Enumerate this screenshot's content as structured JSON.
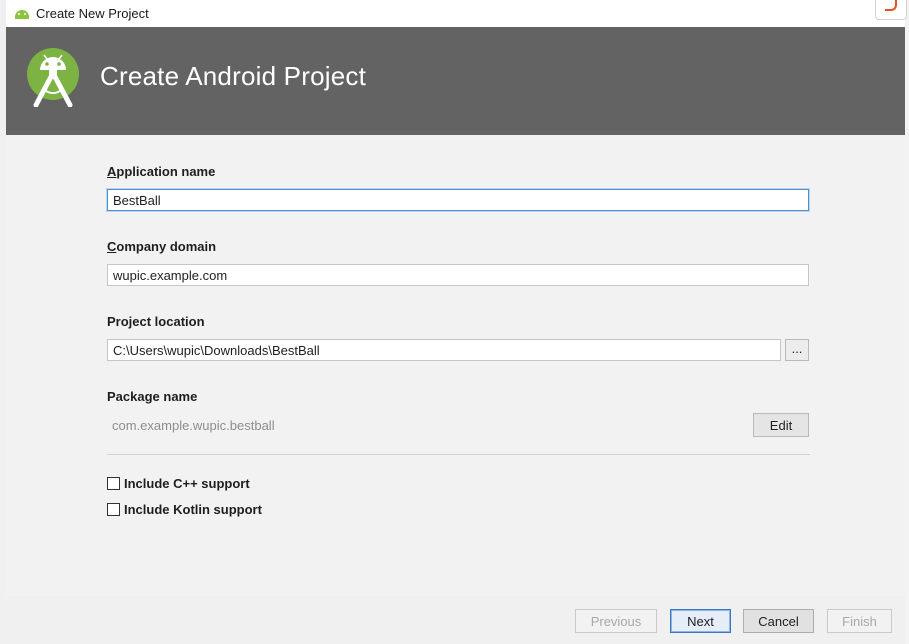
{
  "window": {
    "title": "Create New Project",
    "icon": "android-icon"
  },
  "banner": {
    "heading": "Create Android Project",
    "logo": "android-studio-logo",
    "background_color": "#636363"
  },
  "form": {
    "application_name": {
      "label_mnemonic": "A",
      "label_rest": "pplication name",
      "value": "BestBall"
    },
    "company_domain": {
      "label_mnemonic": "C",
      "label_rest": "ompany domain",
      "value": "wupic.example.com"
    },
    "project_location": {
      "label": "Project location",
      "value": "C:\\Users\\wupic\\Downloads\\BestBall",
      "browse_label": "..."
    },
    "package_name": {
      "label": "Package name",
      "value": "com.example.wupic.bestball",
      "edit_label": "Edit"
    },
    "options": [
      {
        "label": "Include C++ support",
        "checked": false
      },
      {
        "label": "Include Kotlin support",
        "checked": false
      }
    ]
  },
  "footer": {
    "previous_label": "Previous",
    "next_label": "Next",
    "cancel_label": "Cancel",
    "finish_label": "Finish"
  },
  "colors": {
    "accent_focus": "#4d8fd1",
    "android_green": "#8ec33e"
  }
}
